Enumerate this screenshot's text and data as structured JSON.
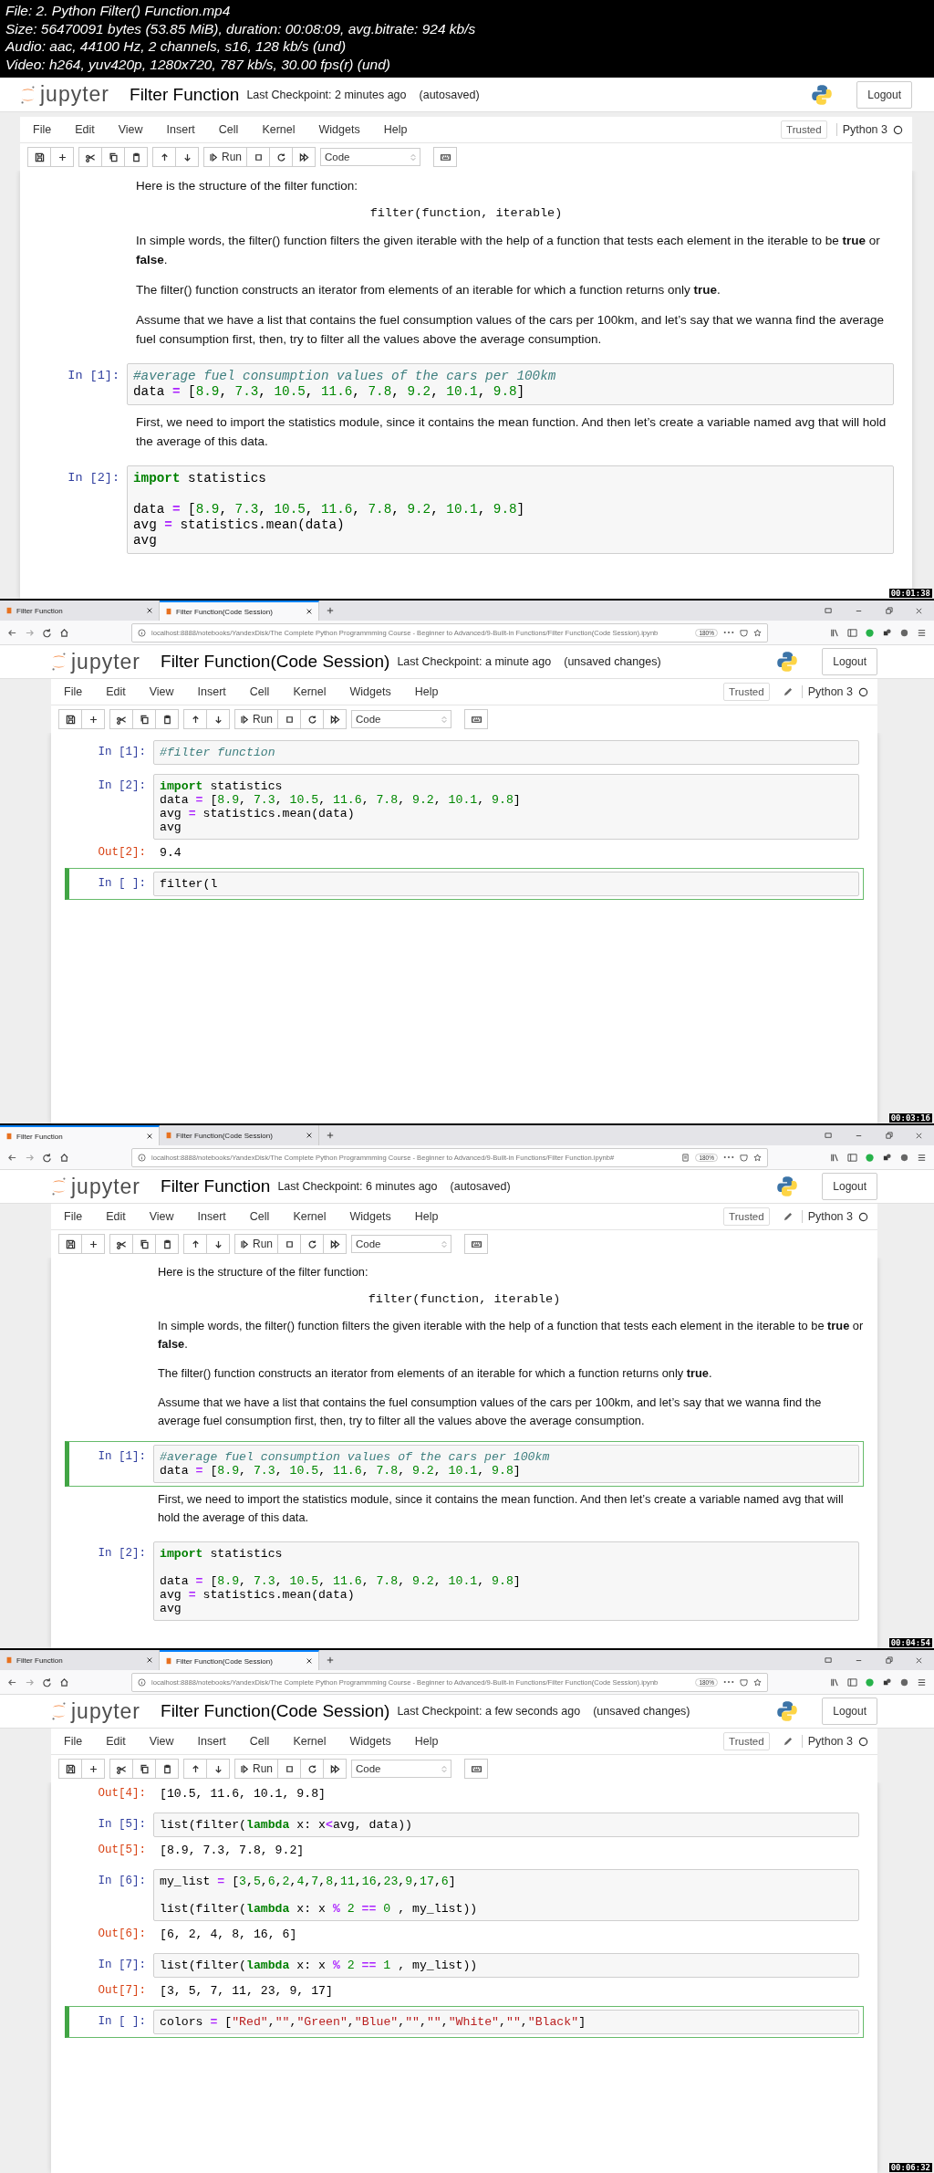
{
  "file_info": [
    "File: 2. Python Filter() Function.mp4",
    "Size: 56470091 bytes (53.85 MiB), duration: 00:08:09, avg.bitrate: 924 kb/s",
    "Audio: aac, 44100 Hz, 2 channels, s16, 128 kb/s (und)",
    "Video: h264, yuv420p, 1280x720, 787 kb/s, 30.00 fps(r) (und)"
  ],
  "frames": [
    {
      "timestamp": "00:01:38",
      "notebook": {
        "logo_text": "jupyter",
        "title": "Filter Function",
        "checkpoint": "Last Checkpoint: 2 minutes ago",
        "save_status": "(autosaved)",
        "logout": "Logout",
        "menu": [
          "File",
          "Edit",
          "View",
          "Insert",
          "Cell",
          "Kernel",
          "Widgets",
          "Help"
        ],
        "trusted": "Trusted",
        "edit_mode": false,
        "kernel": "Python 3",
        "run": "Run",
        "cell_type": "Code"
      },
      "cells": [
        {
          "kind": "markdown",
          "text": "Here is the structure of the filter function:"
        },
        {
          "kind": "formula",
          "text": "filter(function, iterable)"
        },
        {
          "kind": "markdown",
          "text": "In simple words, the filter() function filters the given iterable with the help of a function that tests each element in the iterable to be **true** or **false**."
        },
        {
          "kind": "markdown",
          "text": "The filter() function constructs an iterator from elements of an iterable for which a function returns only **true**."
        },
        {
          "kind": "markdown",
          "text": "Assume that we have a list that contains the fuel consumption values of the cars per 100km, and let’s say that we wanna find the average fuel consumption first, then, try to filter all the values above the average consumption."
        },
        {
          "kind": "code",
          "prompt": "In [1]:",
          "selected": false,
          "lines": [
            {
              "tokens": [
                {
                  "kind": "comment",
                  "text": "#average fuel consumption values of the cars per 100km"
                }
              ]
            },
            {
              "tokens": [
                {
                  "kind": "plain",
                  "text": "data"
                },
                {
                  "kind": "operator",
                  "text": " = "
                },
                {
                  "kind": "plain",
                  "text": "["
                },
                {
                  "kind": "number",
                  "text": "8.9"
                },
                {
                  "kind": "plain",
                  "text": ", "
                },
                {
                  "kind": "number",
                  "text": "7.3"
                },
                {
                  "kind": "plain",
                  "text": ", "
                },
                {
                  "kind": "number",
                  "text": "10.5"
                },
                {
                  "kind": "plain",
                  "text": ", "
                },
                {
                  "kind": "number",
                  "text": "11.6"
                },
                {
                  "kind": "plain",
                  "text": ", "
                },
                {
                  "kind": "number",
                  "text": "7.8"
                },
                {
                  "kind": "plain",
                  "text": ", "
                },
                {
                  "kind": "number",
                  "text": "9.2"
                },
                {
                  "kind": "plain",
                  "text": ", "
                },
                {
                  "kind": "number",
                  "text": "10.1"
                },
                {
                  "kind": "plain",
                  "text": ", "
                },
                {
                  "kind": "number",
                  "text": "9.8"
                },
                {
                  "kind": "plain",
                  "text": "]"
                }
              ]
            }
          ]
        },
        {
          "kind": "markdown",
          "text": "First, we need to import the statistics module, since it contains the mean function. And then let’s create a variable named avg that will hold the average of this data."
        },
        {
          "kind": "code",
          "prompt": "In [2]:",
          "selected": false,
          "lines": [
            {
              "tokens": [
                {
                  "kind": "keyword",
                  "text": "import"
                },
                {
                  "kind": "plain",
                  "text": " statistics"
                }
              ]
            },
            {
              "space_before": true,
              "tokens": [
                {
                  "kind": "plain",
                  "text": "data"
                },
                {
                  "kind": "operator",
                  "text": " = "
                },
                {
                  "kind": "plain",
                  "text": "["
                },
                {
                  "kind": "number",
                  "text": "8.9"
                },
                {
                  "kind": "plain",
                  "text": ", "
                },
                {
                  "kind": "number",
                  "text": "7.3"
                },
                {
                  "kind": "plain",
                  "text": ", "
                },
                {
                  "kind": "number",
                  "text": "10.5"
                },
                {
                  "kind": "plain",
                  "text": ", "
                },
                {
                  "kind": "number",
                  "text": "11.6"
                },
                {
                  "kind": "plain",
                  "text": ", "
                },
                {
                  "kind": "number",
                  "text": "7.8"
                },
                {
                  "kind": "plain",
                  "text": ", "
                },
                {
                  "kind": "number",
                  "text": "9.2"
                },
                {
                  "kind": "plain",
                  "text": ", "
                },
                {
                  "kind": "number",
                  "text": "10.1"
                },
                {
                  "kind": "plain",
                  "text": ", "
                },
                {
                  "kind": "number",
                  "text": "9.8"
                },
                {
                  "kind": "plain",
                  "text": "]"
                }
              ]
            },
            {
              "tokens": [
                {
                  "kind": "plain",
                  "text": "avg"
                },
                {
                  "kind": "operator",
                  "text": " = "
                },
                {
                  "kind": "plain",
                  "text": "statistics.mean(data)"
                }
              ]
            },
            {
              "tokens": [
                {
                  "kind": "plain",
                  "text": "avg"
                }
              ]
            }
          ]
        }
      ]
    },
    {
      "timestamp": "00:03:16",
      "browser": {
        "tabs": [
          {
            "label": "Filter Function",
            "selected": false
          },
          {
            "label": "Filter Function(Code Session)",
            "selected": true
          }
        ],
        "url": "localhost:8888/notebooks/YandexDisk/The Complete Python Programmming Course - Beginner to Advanced/9-Built-in Functions/Filter Function(Code Session).ipynb",
        "reader_view": false,
        "zoom": "180%"
      },
      "notebook": {
        "logo_text": "jupyter",
        "title": "Filter Function(Code Session)",
        "checkpoint": "Last Checkpoint: a minute ago",
        "save_status": "(unsaved changes)",
        "logout": "Logout",
        "menu": [
          "File",
          "Edit",
          "View",
          "Insert",
          "Cell",
          "Kernel",
          "Widgets",
          "Help"
        ],
        "trusted": "Trusted",
        "edit_mode": true,
        "kernel": "Python 3",
        "run": "Run",
        "cell_type": "Code"
      },
      "cells": [
        {
          "kind": "code",
          "prompt": "In [1]:",
          "selected": false,
          "lines": [
            {
              "tokens": [
                {
                  "kind": "comment",
                  "text": "#filter function"
                }
              ]
            }
          ]
        },
        {
          "kind": "code",
          "prompt": "In [2]:",
          "selected": false,
          "lines": [
            {
              "tokens": [
                {
                  "kind": "keyword",
                  "text": "import"
                },
                {
                  "kind": "plain",
                  "text": " statistics"
                }
              ]
            },
            {
              "tokens": [
                {
                  "kind": "plain",
                  "text": "data"
                },
                {
                  "kind": "operator",
                  "text": " = "
                },
                {
                  "kind": "plain",
                  "text": "["
                },
                {
                  "kind": "number",
                  "text": "8.9"
                },
                {
                  "kind": "plain",
                  "text": ", "
                },
                {
                  "kind": "number",
                  "text": "7.3"
                },
                {
                  "kind": "plain",
                  "text": ", "
                },
                {
                  "kind": "number",
                  "text": "10.5"
                },
                {
                  "kind": "plain",
                  "text": ", "
                },
                {
                  "kind": "number",
                  "text": "11.6"
                },
                {
                  "kind": "plain",
                  "text": ", "
                },
                {
                  "kind": "number",
                  "text": "7.8"
                },
                {
                  "kind": "plain",
                  "text": ", "
                },
                {
                  "kind": "number",
                  "text": "9.2"
                },
                {
                  "kind": "plain",
                  "text": ", "
                },
                {
                  "kind": "number",
                  "text": "10.1"
                },
                {
                  "kind": "plain",
                  "text": ", "
                },
                {
                  "kind": "number",
                  "text": "9.8"
                },
                {
                  "kind": "plain",
                  "text": "]"
                }
              ]
            },
            {
              "tokens": [
                {
                  "kind": "plain",
                  "text": "avg"
                },
                {
                  "kind": "operator",
                  "text": " = "
                },
                {
                  "kind": "plain",
                  "text": "statistics.mean(data)"
                }
              ]
            },
            {
              "tokens": [
                {
                  "kind": "plain",
                  "text": "avg"
                }
              ]
            }
          ]
        },
        {
          "kind": "output",
          "prompt": "Out[2]:",
          "text": "9.4"
        },
        {
          "kind": "code",
          "prompt": "In [ ]:",
          "selected": true,
          "lines": [
            {
              "tokens": [
                {
                  "kind": "plain",
                  "text": "filter(l"
                }
              ]
            }
          ]
        }
      ]
    },
    {
      "timestamp": "00:04:54",
      "browser": {
        "tabs": [
          {
            "label": "Filter Function",
            "selected": true
          },
          {
            "label": "Filter Function(Code Session)",
            "selected": false
          }
        ],
        "url": "localhost:8888/notebooks/YandexDisk/The Complete Python Programmming Course - Beginner to Advanced/9-Built-in Functions/Filter Function.ipynb#",
        "reader_view": true,
        "zoom": "180%"
      },
      "notebook": {
        "logo_text": "jupyter",
        "title": "Filter Function",
        "checkpoint": "Last Checkpoint: 6 minutes ago",
        "save_status": "(autosaved)",
        "logout": "Logout",
        "menu": [
          "File",
          "Edit",
          "View",
          "Insert",
          "Cell",
          "Kernel",
          "Widgets",
          "Help"
        ],
        "trusted": "Trusted",
        "edit_mode": true,
        "kernel": "Python 3",
        "run": "Run",
        "cell_type": "Code"
      },
      "cells": [
        {
          "kind": "markdown",
          "text": "Here is the structure of the filter function:"
        },
        {
          "kind": "formula",
          "text": "filter(function, iterable)"
        },
        {
          "kind": "markdown",
          "text": "In simple words, the filter() function filters the given iterable with the help of a function that tests each element in the iterable to be **true** or **false**."
        },
        {
          "kind": "markdown",
          "text": "The filter() function constructs an iterator from elements of an iterable for which a function returns only **true**."
        },
        {
          "kind": "markdown",
          "text": "Assume that we have a list that contains the fuel consumption values of the cars per 100km, and let’s say that we wanna find the average fuel consumption first, then, try to filter all the values above the average consumption."
        },
        {
          "kind": "code",
          "prompt": "In [1]:",
          "selected": true,
          "lines": [
            {
              "tokens": [
                {
                  "kind": "comment",
                  "text": "#average fuel consumption values of the cars per 100km"
                }
              ]
            },
            {
              "tokens": [
                {
                  "kind": "plain",
                  "text": "data"
                },
                {
                  "kind": "operator",
                  "text": " = "
                },
                {
                  "kind": "plain",
                  "text": "["
                },
                {
                  "kind": "number",
                  "text": "8.9"
                },
                {
                  "kind": "plain",
                  "text": ", "
                },
                {
                  "kind": "number",
                  "text": "7.3"
                },
                {
                  "kind": "plain",
                  "text": ", "
                },
                {
                  "kind": "number",
                  "text": "10.5"
                },
                {
                  "kind": "plain",
                  "text": ", "
                },
                {
                  "kind": "number",
                  "text": "11.6"
                },
                {
                  "kind": "plain",
                  "text": ", "
                },
                {
                  "kind": "number",
                  "text": "7.8"
                },
                {
                  "kind": "plain",
                  "text": ", "
                },
                {
                  "kind": "number",
                  "text": "9.2"
                },
                {
                  "kind": "plain",
                  "text": ", "
                },
                {
                  "kind": "number",
                  "text": "10.1"
                },
                {
                  "kind": "plain",
                  "text": ", "
                },
                {
                  "kind": "number",
                  "text": "9.8"
                },
                {
                  "kind": "plain",
                  "text": "]"
                }
              ]
            }
          ]
        },
        {
          "kind": "markdown",
          "text": "First, we need to import the statistics module, since it contains the mean function. And then let’s create a variable named avg that will hold the average of this data."
        },
        {
          "kind": "code",
          "prompt": "In [2]:",
          "selected": false,
          "lines": [
            {
              "tokens": [
                {
                  "kind": "keyword",
                  "text": "import"
                },
                {
                  "kind": "plain",
                  "text": " statistics"
                }
              ]
            },
            {
              "space_before": true,
              "tokens": [
                {
                  "kind": "plain",
                  "text": "data"
                },
                {
                  "kind": "operator",
                  "text": " = "
                },
                {
                  "kind": "plain",
                  "text": "["
                },
                {
                  "kind": "number",
                  "text": "8.9"
                },
                {
                  "kind": "plain",
                  "text": ", "
                },
                {
                  "kind": "number",
                  "text": "7.3"
                },
                {
                  "kind": "plain",
                  "text": ", "
                },
                {
                  "kind": "number",
                  "text": "10.5"
                },
                {
                  "kind": "plain",
                  "text": ", "
                },
                {
                  "kind": "number",
                  "text": "11.6"
                },
                {
                  "kind": "plain",
                  "text": ", "
                },
                {
                  "kind": "number",
                  "text": "7.8"
                },
                {
                  "kind": "plain",
                  "text": ", "
                },
                {
                  "kind": "number",
                  "text": "9.2"
                },
                {
                  "kind": "plain",
                  "text": ", "
                },
                {
                  "kind": "number",
                  "text": "10.1"
                },
                {
                  "kind": "plain",
                  "text": ", "
                },
                {
                  "kind": "number",
                  "text": "9.8"
                },
                {
                  "kind": "plain",
                  "text": "]"
                }
              ]
            },
            {
              "tokens": [
                {
                  "kind": "plain",
                  "text": "avg"
                },
                {
                  "kind": "operator",
                  "text": " = "
                },
                {
                  "kind": "plain",
                  "text": "statistics.mean(data)"
                }
              ]
            },
            {
              "tokens": [
                {
                  "kind": "plain",
                  "text": "avg"
                }
              ]
            }
          ]
        }
      ]
    },
    {
      "timestamp": "00:06:32",
      "browser": {
        "tabs": [
          {
            "label": "Filter Function",
            "selected": false
          },
          {
            "label": "Filter Function(Code Session)",
            "selected": true
          }
        ],
        "url": "localhost:8888/notebooks/YandexDisk/The Complete Python Programmming Course - Beginner to Advanced/9-Built-in Functions/Filter Function(Code Session).ipynb",
        "reader_view": false,
        "zoom": "180%"
      },
      "notebook": {
        "logo_text": "jupyter",
        "title": "Filter Function(Code Session)",
        "checkpoint": "Last Checkpoint: a few seconds ago",
        "save_status": "(unsaved changes)",
        "logout": "Logout",
        "menu": [
          "File",
          "Edit",
          "View",
          "Insert",
          "Cell",
          "Kernel",
          "Widgets",
          "Help"
        ],
        "trusted": "Trusted",
        "edit_mode": true,
        "kernel": "Python 3",
        "run": "Run",
        "cell_type": "Code"
      },
      "cells": [
        {
          "kind": "output",
          "prompt": "Out[4]:",
          "text": "[10.5, 11.6, 10.1, 9.8]"
        },
        {
          "kind": "code",
          "prompt": "In [5]:",
          "selected": false,
          "lines": [
            {
              "tokens": [
                {
                  "kind": "plain",
                  "text": "list(filter("
                },
                {
                  "kind": "keyword",
                  "text": "lambda"
                },
                {
                  "kind": "plain",
                  "text": " x: x"
                },
                {
                  "kind": "operator",
                  "text": "<"
                },
                {
                  "kind": "plain",
                  "text": "avg, data))"
                }
              ]
            }
          ]
        },
        {
          "kind": "output",
          "prompt": "Out[5]:",
          "text": "[8.9, 7.3, 7.8, 9.2]"
        },
        {
          "kind": "code",
          "prompt": "In [6]:",
          "selected": false,
          "lines": [
            {
              "tokens": [
                {
                  "kind": "plain",
                  "text": "my_list"
                },
                {
                  "kind": "operator",
                  "text": " = "
                },
                {
                  "kind": "plain",
                  "text": "["
                },
                {
                  "kind": "number",
                  "text": "3"
                },
                {
                  "kind": "plain",
                  "text": ","
                },
                {
                  "kind": "number",
                  "text": "5"
                },
                {
                  "kind": "plain",
                  "text": ","
                },
                {
                  "kind": "number",
                  "text": "6"
                },
                {
                  "kind": "plain",
                  "text": ","
                },
                {
                  "kind": "number",
                  "text": "2"
                },
                {
                  "kind": "plain",
                  "text": ","
                },
                {
                  "kind": "number",
                  "text": "4"
                },
                {
                  "kind": "plain",
                  "text": ","
                },
                {
                  "kind": "number",
                  "text": "7"
                },
                {
                  "kind": "plain",
                  "text": ","
                },
                {
                  "kind": "number",
                  "text": "8"
                },
                {
                  "kind": "plain",
                  "text": ","
                },
                {
                  "kind": "number",
                  "text": "11"
                },
                {
                  "kind": "plain",
                  "text": ","
                },
                {
                  "kind": "number",
                  "text": "16"
                },
                {
                  "kind": "plain",
                  "text": ","
                },
                {
                  "kind": "number",
                  "text": "23"
                },
                {
                  "kind": "plain",
                  "text": ","
                },
                {
                  "kind": "number",
                  "text": "9"
                },
                {
                  "kind": "plain",
                  "text": ","
                },
                {
                  "kind": "number",
                  "text": "17"
                },
                {
                  "kind": "plain",
                  "text": ","
                },
                {
                  "kind": "number",
                  "text": "6"
                },
                {
                  "kind": "plain",
                  "text": "]"
                }
              ]
            },
            {
              "space_before": true,
              "tokens": [
                {
                  "kind": "plain",
                  "text": "list(filter("
                },
                {
                  "kind": "keyword",
                  "text": "lambda"
                },
                {
                  "kind": "plain",
                  "text": " x: x"
                },
                {
                  "kind": "operator",
                  "text": " % "
                },
                {
                  "kind": "number",
                  "text": "2"
                },
                {
                  "kind": "operator",
                  "text": " == "
                },
                {
                  "kind": "number",
                  "text": "0"
                },
                {
                  "kind": "plain",
                  "text": " , my_list))"
                }
              ]
            }
          ]
        },
        {
          "kind": "output",
          "prompt": "Out[6]:",
          "text": "[6, 2, 4, 8, 16, 6]"
        },
        {
          "kind": "code",
          "prompt": "In [7]:",
          "selected": false,
          "lines": [
            {
              "tokens": [
                {
                  "kind": "plain",
                  "text": "list(filter("
                },
                {
                  "kind": "keyword",
                  "text": "lambda"
                },
                {
                  "kind": "plain",
                  "text": " x: x"
                },
                {
                  "kind": "operator",
                  "text": " % "
                },
                {
                  "kind": "number",
                  "text": "2"
                },
                {
                  "kind": "operator",
                  "text": " == "
                },
                {
                  "kind": "number",
                  "text": "1"
                },
                {
                  "kind": "plain",
                  "text": " , my_list))"
                }
              ]
            }
          ]
        },
        {
          "kind": "output",
          "prompt": "Out[7]:",
          "text": "[3, 5, 7, 11, 23, 9, 17]"
        },
        {
          "kind": "code",
          "prompt": "In [ ]:",
          "selected": true,
          "lines": [
            {
              "tokens": [
                {
                  "kind": "plain",
                  "text": "colors"
                },
                {
                  "kind": "operator",
                  "text": " = "
                },
                {
                  "kind": "plain",
                  "text": "["
                },
                {
                  "kind": "string",
                  "text": "\"Red\""
                },
                {
                  "kind": "plain",
                  "text": ","
                },
                {
                  "kind": "string",
                  "text": "\"\""
                },
                {
                  "kind": "plain",
                  "text": ","
                },
                {
                  "kind": "string",
                  "text": "\"Green\""
                },
                {
                  "kind": "plain",
                  "text": ","
                },
                {
                  "kind": "string",
                  "text": "\"Blue\""
                },
                {
                  "kind": "plain",
                  "text": ","
                },
                {
                  "kind": "string",
                  "text": "\"\""
                },
                {
                  "kind": "plain",
                  "text": ","
                },
                {
                  "kind": "string",
                  "text": "\"\""
                },
                {
                  "kind": "plain",
                  "text": ","
                },
                {
                  "kind": "string",
                  "text": "\"White\""
                },
                {
                  "kind": "plain",
                  "text": ","
                },
                {
                  "kind": "string",
                  "text": "\"\""
                },
                {
                  "kind": "plain",
                  "text": ","
                },
                {
                  "kind": "string",
                  "text": "\"Black\""
                },
                {
                  "kind": "plain",
                  "text": "]"
                }
              ]
            }
          ]
        }
      ]
    }
  ]
}
